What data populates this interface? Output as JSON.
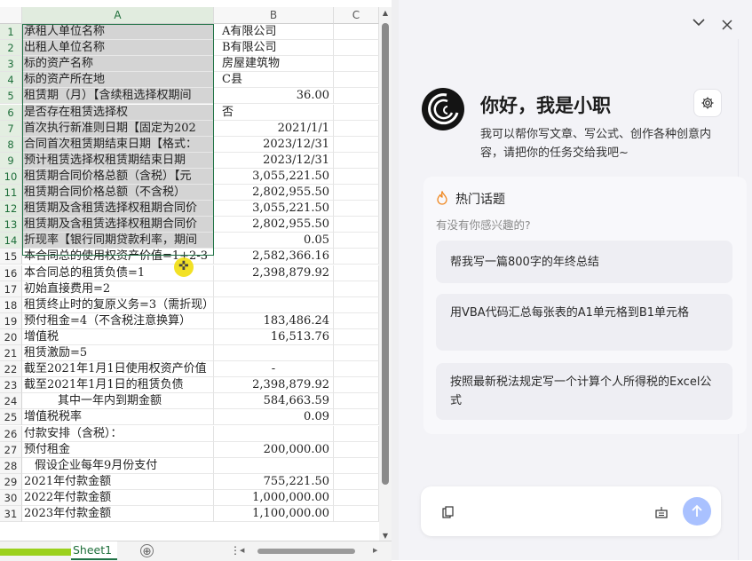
{
  "sheet": {
    "columns": [
      "A",
      "B",
      "C"
    ],
    "rows": [
      {
        "n": "1",
        "a": "承租人单位名称",
        "b": "A有限公司",
        "b_align": "left"
      },
      {
        "n": "2",
        "a": "出租人单位名称",
        "b": "B有限公司",
        "b_align": "left"
      },
      {
        "n": "3",
        "a": "标的资产名称",
        "b": "房屋建筑物",
        "b_align": "left"
      },
      {
        "n": "4",
        "a": "标的资产所在地",
        "b": "C县",
        "b_align": "left"
      },
      {
        "n": "5",
        "a": "租赁期（月）【含续租选择权期间",
        "b": "36.00",
        "b_align": "right"
      },
      {
        "n": "6",
        "a": "是否存在租赁选择权",
        "b": "否",
        "b_align": "left"
      },
      {
        "n": "7",
        "a": "首次执行新准则日期【固定为202",
        "b": "2021/1/1",
        "b_align": "right"
      },
      {
        "n": "8",
        "a": "合同首次租赁期结束日期【格式：",
        "b": "2023/12/31",
        "b_align": "right"
      },
      {
        "n": "9",
        "a": "预计租赁选择权租赁期结束日期",
        "b": "2023/12/31",
        "b_align": "right"
      },
      {
        "n": "10",
        "a": "租赁期合同价格总额（含税）【元",
        "b": "3,055,221.50",
        "b_align": "right"
      },
      {
        "n": "11",
        "a": "租赁期合同价格总额（不含税）",
        "b": "2,802,955.50",
        "b_align": "right"
      },
      {
        "n": "12",
        "a": "租赁期及含租赁选择权租期合同价",
        "b": "3,055,221.50",
        "b_align": "right"
      },
      {
        "n": "13",
        "a": "租赁期及含租赁选择权租期合同价",
        "b": "2,802,955.50",
        "b_align": "right"
      },
      {
        "n": "14",
        "a": "折现率【银行同期贷款利率，期间",
        "b": "0.05",
        "b_align": "right"
      },
      {
        "n": "15",
        "a": "本合同总的使用权资产价值=1+2-3",
        "b": "2,582,366.16",
        "b_align": "right"
      },
      {
        "n": "16",
        "a": "本合同总的租赁负债=1",
        "b": "2,398,879.92",
        "b_align": "right"
      },
      {
        "n": "17",
        "a": "初始直接费用=2",
        "b": "",
        "b_align": "right"
      },
      {
        "n": "18",
        "a": "租赁终止时的复原义务=3（需折现）",
        "b": "",
        "b_align": "right"
      },
      {
        "n": "19",
        "a": "预付租金=4（不含税注意换算）",
        "b": "183,486.24",
        "b_align": "right"
      },
      {
        "n": "20",
        "a": "增值税",
        "b": "16,513.76",
        "b_align": "right"
      },
      {
        "n": "21",
        "a": "租赁激励=5",
        "b": "",
        "b_align": "right"
      },
      {
        "n": "22",
        "a": "截至2021年1月1日使用权资产价值",
        "b": "-",
        "b_align": "center"
      },
      {
        "n": "23",
        "a": "截至2021年1月1日的租赁负债",
        "b": "2,398,879.92",
        "b_align": "right"
      },
      {
        "n": "24",
        "a": "其中一年内到期金额",
        "b": "584,663.59",
        "b_align": "right",
        "indent": true
      },
      {
        "n": "25",
        "a": "增值税税率",
        "b": "0.09",
        "b_align": "right"
      },
      {
        "n": "26",
        "a": "付款安排（含税）：",
        "b": "",
        "b_align": "right"
      },
      {
        "n": "27",
        "a": "预付租金",
        "b": "200,000.00",
        "b_align": "right"
      },
      {
        "n": "28",
        "a": "假设企业每年9月份支付",
        "b": "",
        "b_align": "right",
        "indent2": true
      },
      {
        "n": "29",
        "a": "2021年付款金额",
        "b": "755,221.50",
        "b_align": "right"
      },
      {
        "n": "30",
        "a": "2022年付款金额",
        "b": "1,000,000.00",
        "b_align": "right"
      },
      {
        "n": "31",
        "a": "2023年付款金额",
        "b": "1,100,000.00",
        "b_align": "right"
      }
    ],
    "selected_rows": 14,
    "tab_name": "Sheet1",
    "tab_add": "⊕",
    "tab_more": "⋮"
  },
  "assistant": {
    "greeting": "你好，我是小职",
    "intro": "我可以帮你写文章、写公式、创作各种创意内容，请把你的任务交给我吧~",
    "topics_title": "热门话题",
    "topics_subtitle": "有没有你感兴趣的?",
    "topics": [
      "帮我写一篇800字的年终总结",
      "用VBA代码汇总每张表的A1单元格到B1单元格",
      "按照最新税法规定写一个计算个人所得税的Excel公式"
    ],
    "colors": {
      "send": "#a9c1ff",
      "accent": "#217346",
      "tab_accent": "#9bd11d"
    }
  }
}
